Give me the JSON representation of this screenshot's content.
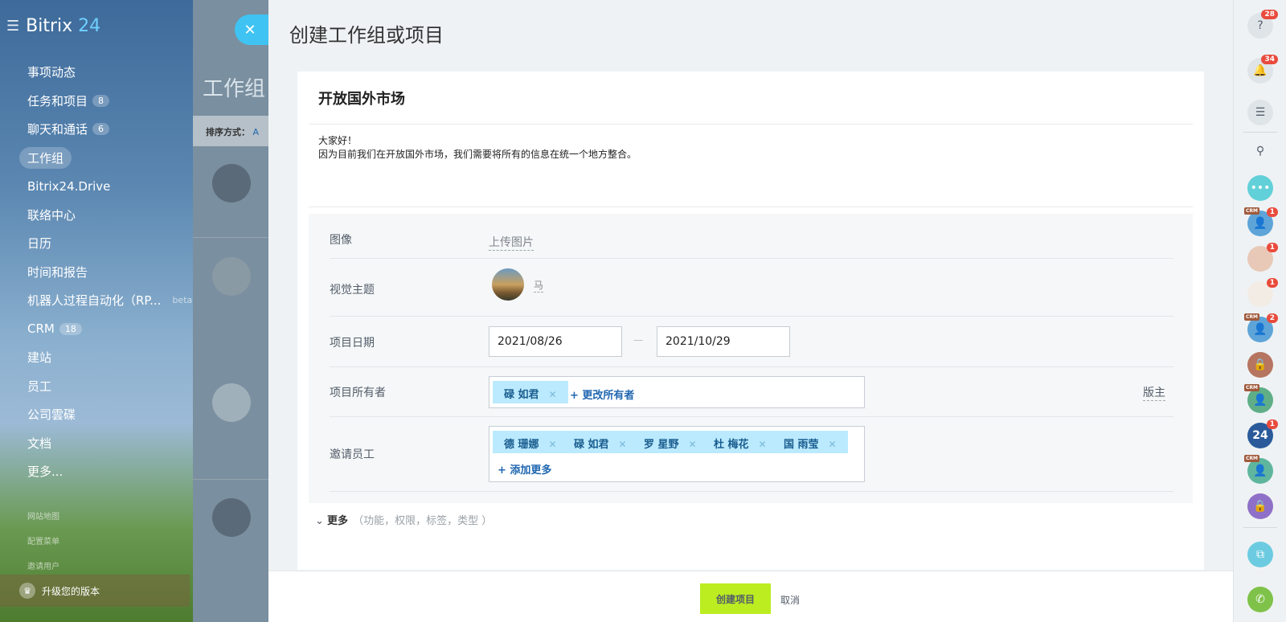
{
  "sidebar": {
    "brand": "Bitrix",
    "brand_num": "24",
    "items": [
      {
        "label": "事项动态",
        "badge": ""
      },
      {
        "label": "任务和项目",
        "badge": "8"
      },
      {
        "label": "聊天和通话",
        "badge": "6"
      },
      {
        "label": "工作组",
        "badge": ""
      },
      {
        "label": "Bitrix24.Drive",
        "badge": ""
      },
      {
        "label": "联络中心",
        "badge": ""
      },
      {
        "label": "日历",
        "badge": ""
      },
      {
        "label": "时间和报告",
        "badge": ""
      },
      {
        "label": "机器人过程自动化（RP...",
        "badge": "",
        "beta": "beta"
      },
      {
        "label": "CRM",
        "badge": "18"
      },
      {
        "label": "建站",
        "badge": ""
      },
      {
        "label": "员工",
        "badge": ""
      },
      {
        "label": "公司雲碟",
        "badge": ""
      },
      {
        "label": "文档",
        "badge": ""
      },
      {
        "label": "更多...",
        "badge": ""
      }
    ],
    "small_links": [
      "网站地图",
      "配置菜单",
      "邀请用户"
    ],
    "upgrade": "升级您的版本"
  },
  "background": {
    "header": "工作组",
    "sort_label": "排序方式：",
    "sort_value": "A"
  },
  "panel": {
    "title": "创建工作组或项目",
    "group_name": "开放国外市场",
    "description_line1": "大家好！",
    "description_line2": "因为目前我们在开放国外市场，我们需要将所有的信息在统一个地方整合。",
    "image_label": "图像",
    "upload_label": "上传图片",
    "theme_label": "视觉主题",
    "theme_name": "马",
    "dates_label": "项目日期",
    "date_start": "2021/08/26",
    "date_end": "2021/10/29",
    "owner_label": "项目所有者",
    "owner": "碌 如君",
    "change_owner": "+ 更改所有者",
    "moderators": "版主",
    "invite_label": "邀请员工",
    "invitees": [
      "德 珊娜",
      "碌 如君",
      "罗 星野",
      "杜 梅花",
      "国 雨莹"
    ],
    "add_more": "+ 添加更多",
    "more_label": "更多",
    "more_hint": "（功能，权限，标签，类型 ）",
    "create_button": "创建项目",
    "cancel_button": "取消"
  },
  "rail": {
    "help_badge": "28",
    "bell_badge": "34",
    "badges": [
      "1",
      "1",
      "1",
      "2",
      "1"
    ],
    "crm": "CRM",
    "b24": "24"
  }
}
